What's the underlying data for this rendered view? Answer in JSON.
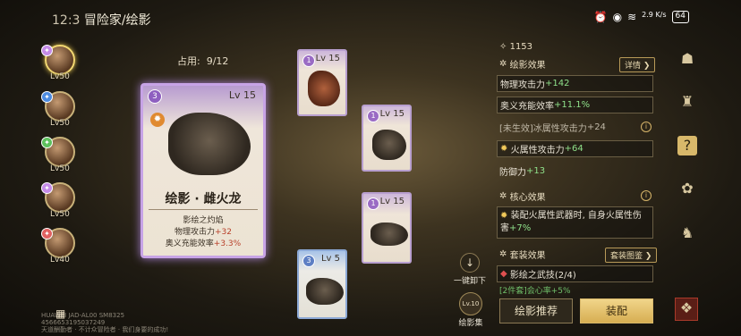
{
  "status": {
    "time": "12:3",
    "breadcrumb": "冒险家/绘影",
    "net_speed": "2.9\nK/s",
    "battery": "64"
  },
  "capacity": {
    "label": "占用:",
    "value": "9/12"
  },
  "heroes": [
    {
      "lv": "Lv50",
      "selected": true
    },
    {
      "lv": "Lv50",
      "selected": false
    },
    {
      "lv": "Lv50",
      "selected": false
    },
    {
      "lv": "Lv50",
      "selected": false
    },
    {
      "lv": "Lv40",
      "selected": false
    }
  ],
  "big_card": {
    "rank": "3",
    "level": "Lv 15",
    "name": "绘影 · 雌火龙",
    "skill": "影绘之灼焰",
    "stat1_label": "物理攻击力",
    "stat1_value": "+32",
    "stat2_label": "奥义充能效率",
    "stat2_value": "+3.3%"
  },
  "small_cards": [
    {
      "rank": "1",
      "level": "Lv 15"
    },
    {
      "rank": "1",
      "level": "Lv 15"
    },
    {
      "rank": "1",
      "level": "Lv 15"
    },
    {
      "rank": "3",
      "level": "Lv 5"
    }
  ],
  "actions": {
    "unload_label": "一键卸下",
    "collection_label": "绘影集",
    "collection_lv": "Lv.10",
    "recommend_label": "绘影推荐",
    "equip_label": "装配"
  },
  "panel": {
    "currency": "1153",
    "effects_title": "绘影效果",
    "details_btn": "详情",
    "stat_rows": [
      {
        "label": "物理攻击力",
        "value": "+142",
        "inactive": false
      },
      {
        "label": "奥义充能效率",
        "value": "+11.1%",
        "inactive": false
      },
      {
        "label": "[未生效]冰属性攻击力",
        "value": "+24",
        "inactive": true
      },
      {
        "label": "火属性攻击力",
        "value": "+64",
        "inactive": false
      },
      {
        "label": "防御力",
        "value": "+13",
        "inactive": false
      }
    ],
    "core_title": "核心效果",
    "core_text_1": "装配火属性武器时, 自身火属性伤",
    "core_text_2": "害",
    "core_value": "+7%",
    "set_title": "套装效果",
    "set_btn": "套装图鉴",
    "set_name": "影绘之武技(2/4)",
    "set_hint": "[2件套]会心率+5%"
  },
  "device": {
    "line1": "HUAWEI JAD-AL00 SM8325",
    "line2": "4566653195037249",
    "line3": "天道酬勤者 · 不计众冒险者 · 我们身要的成功!"
  },
  "colors": {
    "accent_gold": "#d7ae52",
    "green": "#8fe08a",
    "purple": "#b79bd0"
  }
}
